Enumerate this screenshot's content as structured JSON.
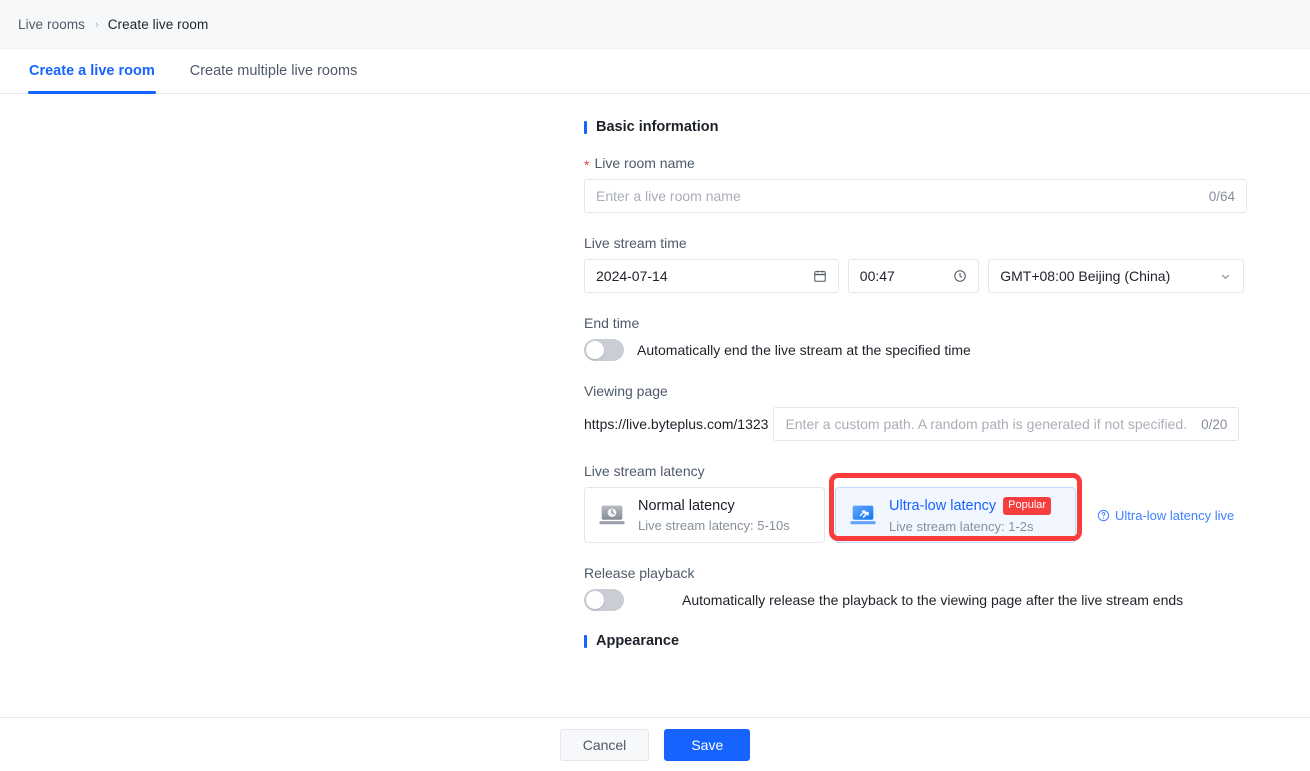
{
  "breadcrumb": {
    "root": "Live rooms",
    "separator": "›",
    "current": "Create live room"
  },
  "tabs": [
    {
      "label": "Create a live room",
      "active": true
    },
    {
      "label": "Create multiple live rooms",
      "active": false
    }
  ],
  "sections": {
    "basic": {
      "title": "Basic information"
    },
    "appearance": {
      "title": "Appearance"
    }
  },
  "fields": {
    "room_name": {
      "label": "Live room name",
      "required_mark": "*",
      "placeholder": "Enter a live room name",
      "counter": "0/64"
    },
    "stream_time": {
      "label": "Live stream time",
      "date_value": "2024-07-14",
      "time_value": "00:47",
      "timezone_value": "GMT+08:00 Beijing (China)",
      "calendar_icon": "calendar-icon",
      "clock_icon": "clock-icon",
      "chevron_icon": "chevron-down-icon"
    },
    "end_time": {
      "label": "End time",
      "toggle_state": "off",
      "description": "Automatically end the live stream at the specified time"
    },
    "viewing_page": {
      "label": "Viewing page",
      "url_prefix": "https://live.byteplus.com/1323",
      "placeholder": "Enter a custom path. A random path is generated if not specified.",
      "counter": "0/20"
    },
    "latency": {
      "label": "Live stream latency",
      "options": [
        {
          "title": "Normal latency",
          "subtitle": "Live stream latency: 5-10s",
          "badge": "",
          "selected": false,
          "icon": "laptop-clock-icon"
        },
        {
          "title": "Ultra-low latency",
          "subtitle": "Live stream latency: 1-2s",
          "badge": "Popular",
          "selected": true,
          "icon": "laptop-speed-icon"
        }
      ],
      "help_link": "Ultra-low latency live",
      "help_icon": "question-circle-icon"
    },
    "release_playback": {
      "label": "Release playback",
      "toggle_state": "off",
      "description": "Automatically release the playback to the viewing page after the live stream ends"
    }
  },
  "footer": {
    "cancel_label": "Cancel",
    "save_label": "Save"
  },
  "colors": {
    "accent": "#1664ff",
    "danger": "#f53f3f",
    "annotation": "#fa3c3c",
    "muted": "#86909c"
  }
}
